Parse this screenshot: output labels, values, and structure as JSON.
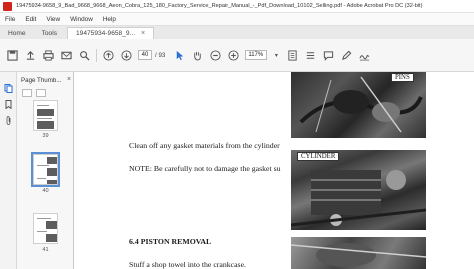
{
  "window": {
    "title": "19475934-9658_9_Bad_9668_9668_Aeon_Cobra_125_180_Factory_Service_Repair_Manual_-_Pdf_Download_10102_Selling.pdf - Adobe Acrobat Pro DC (32-bit)"
  },
  "menu": {
    "items": [
      "File",
      "Edit",
      "View",
      "Window",
      "Help"
    ]
  },
  "tabs": {
    "home": "Home",
    "tools": "Tools",
    "document": "19475934-9658_9...",
    "close": "×"
  },
  "toolbar": {
    "current_page": "40",
    "page_total": "/ 93",
    "zoom": "117%",
    "icons": [
      "save-icon",
      "upload-icon",
      "print-icon",
      "email-icon",
      "search-icon",
      "prev-page-icon",
      "next-page-icon",
      "select-cursor-icon",
      "hand-icon",
      "zoom-out-icon",
      "zoom-in-icon",
      "fit-icon",
      "scroll-icon",
      "comment-icon",
      "pen-icon",
      "sign-icon"
    ]
  },
  "thumbnails": {
    "title": "Page Thumb...",
    "close": "×",
    "pages": [
      {
        "label": "39"
      },
      {
        "label": "40"
      },
      {
        "label": "41"
      }
    ]
  },
  "document": {
    "line1": "Clean off any gasket materials from the cylinder",
    "line2": "NOTE: Be carefully not to damage the gasket su",
    "heading": "6.4 PISTON REMOVAL",
    "line3": "Stuff a shop towel into the crankcase.",
    "pins_label": "PINS",
    "cylinder_label": "CYLINDER"
  }
}
